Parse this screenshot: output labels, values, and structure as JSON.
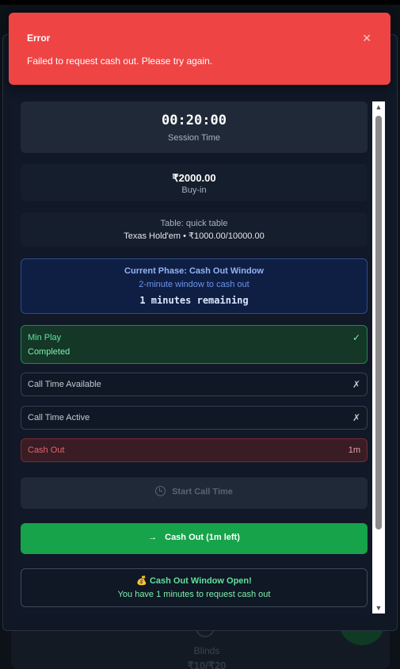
{
  "toast": {
    "title": "Error",
    "message": "Failed to request cash out. Please try again.",
    "close_icon": "close-icon"
  },
  "background": {
    "blinds_label": "Blinds",
    "blinds_value": "₹10/₹20"
  },
  "session": {
    "time": "00:20:00",
    "label": "Session Time"
  },
  "buyin": {
    "amount": "₹2000.00",
    "label": "Buy-in"
  },
  "table": {
    "name": "Table: quick table",
    "game": "Texas Hold'em • ₹1000.00/10000.00"
  },
  "phase": {
    "title": "Current Phase: Cash Out Window",
    "subtitle": "2-minute window to cash out",
    "remaining": "1 minutes remaining"
  },
  "milestones": [
    {
      "name": "Min Play",
      "status": "Completed",
      "mark": "✓"
    },
    {
      "name": "Call Time Available",
      "mark": "✗"
    },
    {
      "name": "Call Time Active",
      "mark": "✗"
    },
    {
      "name": "Cash Out",
      "time": "1m"
    }
  ],
  "buttons": {
    "start_call_time": "Start Call Time",
    "cash_out": "Cash Out (1m left)"
  },
  "window_open": {
    "title": "💰 Cash Out Window Open!",
    "subtitle": "You have 1 minutes to request cash out"
  },
  "colors": {
    "error": "#ef4444",
    "success": "#16a34a",
    "info": "#2c4b8d",
    "danger": "#7a2a33"
  }
}
